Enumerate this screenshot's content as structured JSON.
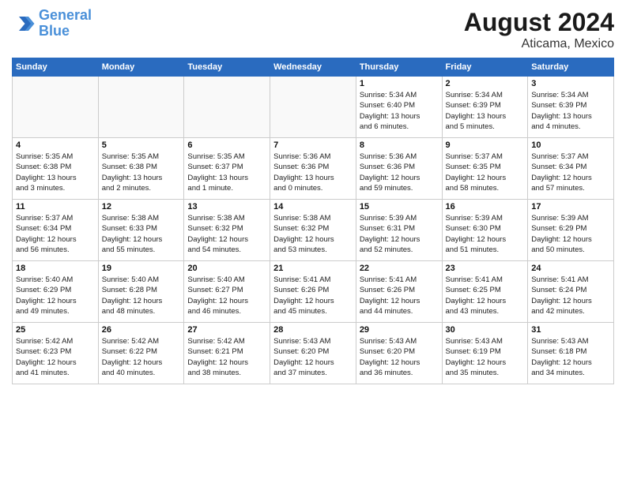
{
  "header": {
    "logo_line1": "General",
    "logo_line2": "Blue",
    "month": "August 2024",
    "location": "Aticama, Mexico"
  },
  "weekdays": [
    "Sunday",
    "Monday",
    "Tuesday",
    "Wednesday",
    "Thursday",
    "Friday",
    "Saturday"
  ],
  "weeks": [
    [
      {
        "day": "",
        "info": ""
      },
      {
        "day": "",
        "info": ""
      },
      {
        "day": "",
        "info": ""
      },
      {
        "day": "",
        "info": ""
      },
      {
        "day": "1",
        "info": "Sunrise: 5:34 AM\nSunset: 6:40 PM\nDaylight: 13 hours\nand 6 minutes."
      },
      {
        "day": "2",
        "info": "Sunrise: 5:34 AM\nSunset: 6:39 PM\nDaylight: 13 hours\nand 5 minutes."
      },
      {
        "day": "3",
        "info": "Sunrise: 5:34 AM\nSunset: 6:39 PM\nDaylight: 13 hours\nand 4 minutes."
      }
    ],
    [
      {
        "day": "4",
        "info": "Sunrise: 5:35 AM\nSunset: 6:38 PM\nDaylight: 13 hours\nand 3 minutes."
      },
      {
        "day": "5",
        "info": "Sunrise: 5:35 AM\nSunset: 6:38 PM\nDaylight: 13 hours\nand 2 minutes."
      },
      {
        "day": "6",
        "info": "Sunrise: 5:35 AM\nSunset: 6:37 PM\nDaylight: 13 hours\nand 1 minute."
      },
      {
        "day": "7",
        "info": "Sunrise: 5:36 AM\nSunset: 6:36 PM\nDaylight: 13 hours\nand 0 minutes."
      },
      {
        "day": "8",
        "info": "Sunrise: 5:36 AM\nSunset: 6:36 PM\nDaylight: 12 hours\nand 59 minutes."
      },
      {
        "day": "9",
        "info": "Sunrise: 5:37 AM\nSunset: 6:35 PM\nDaylight: 12 hours\nand 58 minutes."
      },
      {
        "day": "10",
        "info": "Sunrise: 5:37 AM\nSunset: 6:34 PM\nDaylight: 12 hours\nand 57 minutes."
      }
    ],
    [
      {
        "day": "11",
        "info": "Sunrise: 5:37 AM\nSunset: 6:34 PM\nDaylight: 12 hours\nand 56 minutes."
      },
      {
        "day": "12",
        "info": "Sunrise: 5:38 AM\nSunset: 6:33 PM\nDaylight: 12 hours\nand 55 minutes."
      },
      {
        "day": "13",
        "info": "Sunrise: 5:38 AM\nSunset: 6:32 PM\nDaylight: 12 hours\nand 54 minutes."
      },
      {
        "day": "14",
        "info": "Sunrise: 5:38 AM\nSunset: 6:32 PM\nDaylight: 12 hours\nand 53 minutes."
      },
      {
        "day": "15",
        "info": "Sunrise: 5:39 AM\nSunset: 6:31 PM\nDaylight: 12 hours\nand 52 minutes."
      },
      {
        "day": "16",
        "info": "Sunrise: 5:39 AM\nSunset: 6:30 PM\nDaylight: 12 hours\nand 51 minutes."
      },
      {
        "day": "17",
        "info": "Sunrise: 5:39 AM\nSunset: 6:29 PM\nDaylight: 12 hours\nand 50 minutes."
      }
    ],
    [
      {
        "day": "18",
        "info": "Sunrise: 5:40 AM\nSunset: 6:29 PM\nDaylight: 12 hours\nand 49 minutes."
      },
      {
        "day": "19",
        "info": "Sunrise: 5:40 AM\nSunset: 6:28 PM\nDaylight: 12 hours\nand 48 minutes."
      },
      {
        "day": "20",
        "info": "Sunrise: 5:40 AM\nSunset: 6:27 PM\nDaylight: 12 hours\nand 46 minutes."
      },
      {
        "day": "21",
        "info": "Sunrise: 5:41 AM\nSunset: 6:26 PM\nDaylight: 12 hours\nand 45 minutes."
      },
      {
        "day": "22",
        "info": "Sunrise: 5:41 AM\nSunset: 6:26 PM\nDaylight: 12 hours\nand 44 minutes."
      },
      {
        "day": "23",
        "info": "Sunrise: 5:41 AM\nSunset: 6:25 PM\nDaylight: 12 hours\nand 43 minutes."
      },
      {
        "day": "24",
        "info": "Sunrise: 5:41 AM\nSunset: 6:24 PM\nDaylight: 12 hours\nand 42 minutes."
      }
    ],
    [
      {
        "day": "25",
        "info": "Sunrise: 5:42 AM\nSunset: 6:23 PM\nDaylight: 12 hours\nand 41 minutes."
      },
      {
        "day": "26",
        "info": "Sunrise: 5:42 AM\nSunset: 6:22 PM\nDaylight: 12 hours\nand 40 minutes."
      },
      {
        "day": "27",
        "info": "Sunrise: 5:42 AM\nSunset: 6:21 PM\nDaylight: 12 hours\nand 38 minutes."
      },
      {
        "day": "28",
        "info": "Sunrise: 5:43 AM\nSunset: 6:20 PM\nDaylight: 12 hours\nand 37 minutes."
      },
      {
        "day": "29",
        "info": "Sunrise: 5:43 AM\nSunset: 6:20 PM\nDaylight: 12 hours\nand 36 minutes."
      },
      {
        "day": "30",
        "info": "Sunrise: 5:43 AM\nSunset: 6:19 PM\nDaylight: 12 hours\nand 35 minutes."
      },
      {
        "day": "31",
        "info": "Sunrise: 5:43 AM\nSunset: 6:18 PM\nDaylight: 12 hours\nand 34 minutes."
      }
    ]
  ]
}
